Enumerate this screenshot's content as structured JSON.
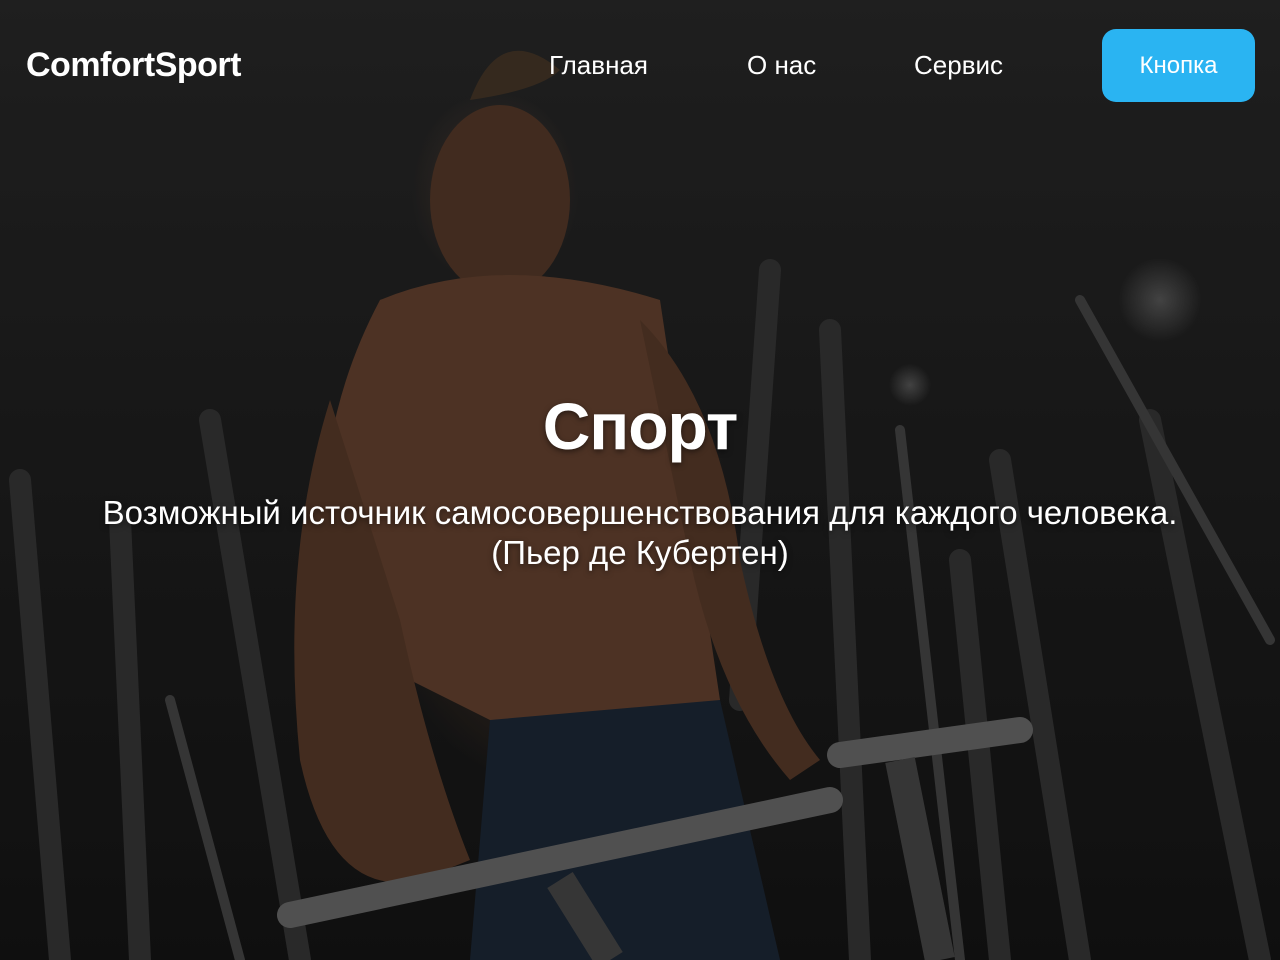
{
  "header": {
    "logo": "ComfortSport",
    "nav": [
      {
        "label": "Главная"
      },
      {
        "label": "О нас"
      },
      {
        "label": "Сервис"
      }
    ],
    "button_label": "Кнопка",
    "accent_color": "#2ab4f2"
  },
  "hero": {
    "background": "gym-athlete-photo",
    "title": "Спорт",
    "quote_line1": "Возможный источник самосовершенствования для каждого человека.",
    "quote_line2": "(Пьер де Кубертен)"
  }
}
